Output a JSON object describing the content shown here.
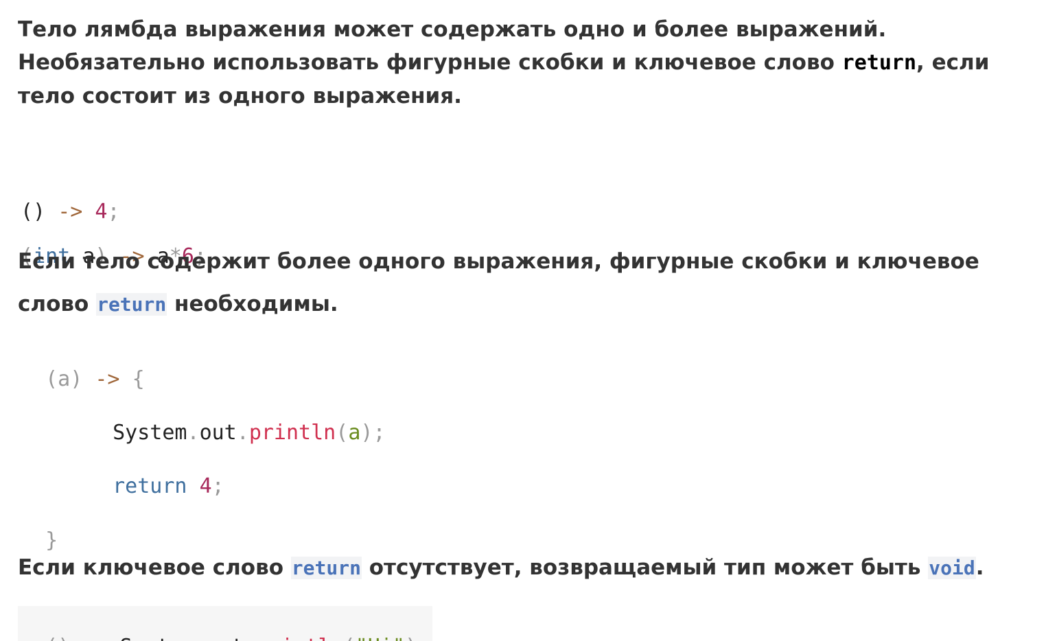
{
  "para1": {
    "line1": "Тело лямбда выражения может содержать одно и более выражений.",
    "line2_before": "Необязательно использовать фигурные скобки и ключевое слово ",
    "line2_keyword": "return",
    "line2_after": ", если",
    "line3": "тело состоит из одного выражения."
  },
  "code1": {
    "line1": {
      "open": "()",
      "arrow": "->",
      "value": "4",
      "semi": ";"
    },
    "line2": {
      "open": "(",
      "type": "int",
      "param": "a",
      "close": ")",
      "arrow": "->",
      "var": "a",
      "op": "*",
      "value": "6",
      "semi": ";"
    }
  },
  "para2": {
    "line1": "Если тело содержит более одного выражения, фигурные скобки и ключевое",
    "line2_before": "слово ",
    "line2_keyword": "return",
    "line2_after": " необходимы."
  },
  "code2": {
    "head": {
      "param": "(a)",
      "arrow": "->",
      "brace": "{"
    },
    "stmt1": {
      "cls": "System",
      "dot1": ".",
      "field": "out",
      "dot2": ".",
      "method": "println",
      "open": "(",
      "arg": "a",
      "close": ")",
      "semi": ";"
    },
    "stmt2": {
      "kw": "return",
      "value": "4",
      "semi": ";"
    },
    "end": "}"
  },
  "para3": {
    "before": "Если ключевое слово ",
    "keyword1": "return",
    "middle": " отсутствует, возвращаемый тип может быть ",
    "keyword2": "void",
    "after": "."
  },
  "code3": {
    "open": "()",
    "arrow": "->",
    "cls": "System",
    "dot1": ".",
    "field": "out",
    "dot2": ".",
    "method": "println",
    "lparen": "(",
    "str": "\"Hi\"",
    "rparen": ")",
    "semi": ";"
  },
  "colors": {
    "text": "#333333",
    "inline_keyword": "#4a73b8",
    "code_arrow": "#a0673a",
    "code_number": "#a8295b",
    "code_keyword": "#3f6f9e",
    "code_method": "#d0304f",
    "code_string": "#6a8c1f"
  }
}
